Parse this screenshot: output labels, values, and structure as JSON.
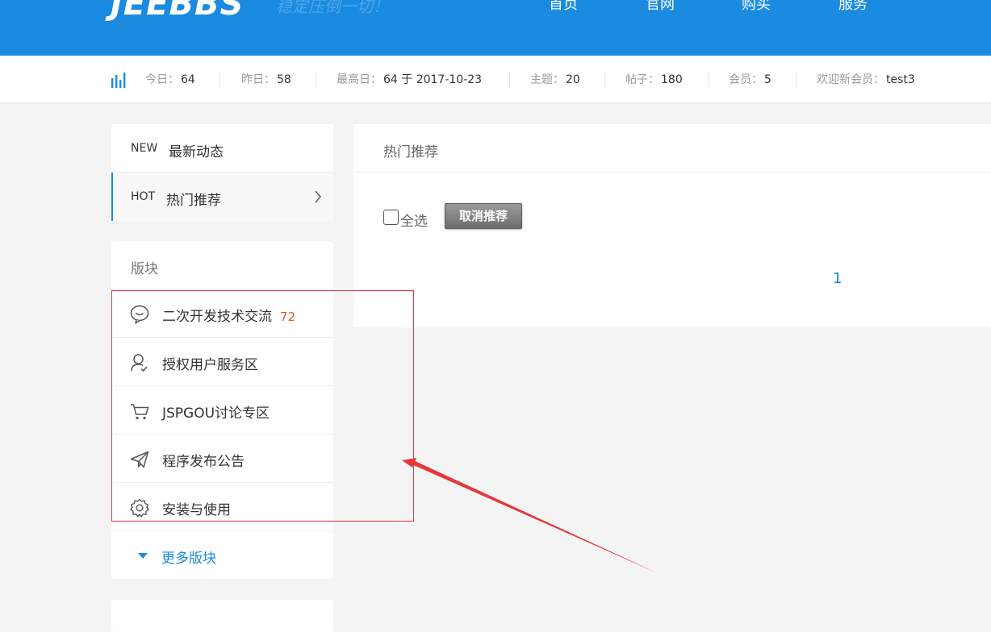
{
  "header": {
    "logo": "JEEBBS",
    "slogan": "稳定压倒一切！",
    "nav": [
      "首页",
      "官网",
      "购买",
      "服务"
    ]
  },
  "stats": {
    "today_label": "今日：",
    "today_value": "64",
    "yesterday_label": "昨日：",
    "yesterday_value": "58",
    "peak_label": "最高日：",
    "peak_value": "64 于 2017-10-23",
    "topics_label": "主题：",
    "topics_value": "20",
    "posts_label": "帖子：",
    "posts_value": "180",
    "members_label": "会员：",
    "members_value": "5",
    "newmember_label": "欢迎新会员：",
    "newmember_value": "test3"
  },
  "side_nav": {
    "items": [
      {
        "tag": "NEW",
        "title": "最新动态"
      },
      {
        "tag": "HOT",
        "title": "热门推荐"
      }
    ]
  },
  "forums": {
    "section_label": "版块",
    "items": [
      {
        "name": "二次开发技术交流",
        "count": "72",
        "icon": "chat-bubble-icon"
      },
      {
        "name": "授权用户服务区",
        "icon": "user-check-icon"
      },
      {
        "name": "JSPGOU讨论专区",
        "icon": "cart-icon"
      },
      {
        "name": "程序发布公告",
        "icon": "paper-plane-icon"
      },
      {
        "name": "安装与使用",
        "icon": "gear-icon"
      }
    ],
    "more_label": "更多版块"
  },
  "main": {
    "title": "热门推荐",
    "select_all_label": "全选",
    "cancel_button": "取消推荐",
    "page_number": "1"
  },
  "colors": {
    "brand": "#1a8be0",
    "count": "#e8541e",
    "annotation": "#e8363a"
  }
}
